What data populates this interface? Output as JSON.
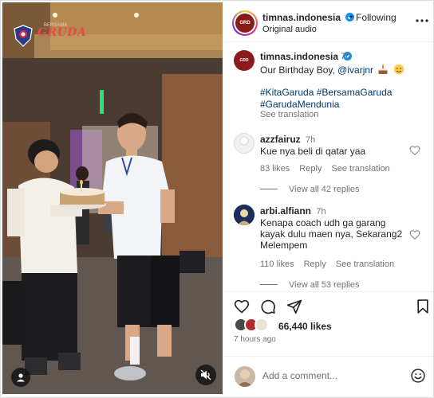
{
  "header": {
    "username": "timnas.indonesia",
    "follow_separator": "•",
    "follow_state": "Following",
    "audio": "Original audio",
    "more_icon": "more-horizontal-icon"
  },
  "media": {
    "logo_text": "GRUDA",
    "logo_small": "BERSAMA",
    "avatar_icon": "user-icon",
    "mute_icon": "speaker-muted-icon"
  },
  "caption": {
    "username": "timnas.indonesia",
    "time": "7h",
    "text": "Our Birthday Boy,",
    "mention": "@ivarjnr",
    "emojis": [
      "birthday-cake-emoji",
      "face-emoji"
    ],
    "hashtags": "#KitaGaruda #BersamaGaruda #GarudaMendunia",
    "see_translation": "See translation"
  },
  "comments": [
    {
      "username": "azzfairuz",
      "time": "7h",
      "text": "Kue nya beli di qatar yaa",
      "likes": "83 likes",
      "reply": "Reply",
      "see_translation": "See translation",
      "view_replies": "View all 42 replies",
      "heart_icon": "heart-outline-icon"
    },
    {
      "username": "arbi.alfiann",
      "time": "7h",
      "text": "Kenapa coach udh ga garang kayak dulu maen nya, Sekarang2 Melempem",
      "likes": "110 likes",
      "reply": "Reply",
      "see_translation": "See translation",
      "view_replies": "View all 53 replies",
      "heart_icon": "heart-outline-icon"
    }
  ],
  "actions": {
    "icons": [
      "heart-icon",
      "comment-icon",
      "share-icon",
      "bookmark-icon"
    ],
    "likes": "66,440 likes",
    "posted": "7 hours ago"
  },
  "comment_box": {
    "placeholder": "Add a comment...",
    "emoji_icon": "smiley-icon"
  },
  "colors": {
    "link": "#00376b",
    "muted": "#737373",
    "verified": "#0095f6",
    "brand_red": "#8b1a1a"
  }
}
